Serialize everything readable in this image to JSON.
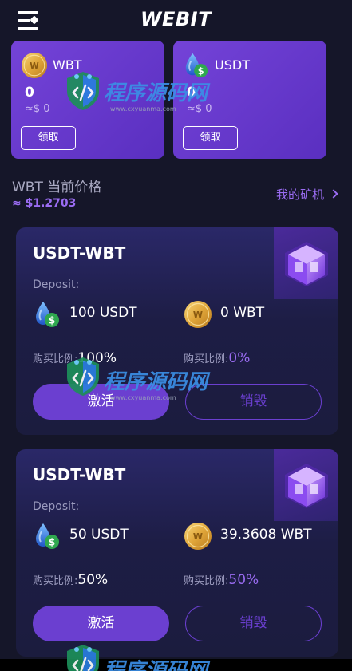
{
  "header": {
    "brand": "WEBIT",
    "menu_icon": "menu-icon"
  },
  "tokens": [
    {
      "symbol": "WBT",
      "amount": "0",
      "fiat": "≈$ 0",
      "claim_label": "领取",
      "icon": "wbt-coin-icon",
      "color": "#e2a93a"
    },
    {
      "symbol": "USDT",
      "amount": "0",
      "fiat": "≈$ 0",
      "claim_label": "领取",
      "icon": "usdt-drop-icon",
      "color": "#2f6fe0"
    }
  ],
  "price": {
    "label": "WBT 当前价格",
    "value": "≈ $1.2703"
  },
  "my_miner": {
    "label": "我的矿机",
    "icon": "chevron-right-icon"
  },
  "pools": [
    {
      "title": "USDT-WBT",
      "deposit_label": "Deposit:",
      "left_amount": "100 USDT",
      "right_amount": "0 WBT",
      "ratio_label_left": "购买比例:",
      "ratio_value_left": "100%",
      "ratio_label_right": "购买比例:",
      "ratio_value_right": "0%",
      "activate_label": "激活",
      "destroy_label": "销毁"
    },
    {
      "title": "USDT-WBT",
      "deposit_label": "Deposit:",
      "left_amount": "50 USDT",
      "right_amount": "39.3608 WBT",
      "ratio_label_left": "购买比例:",
      "ratio_value_left": "50%",
      "ratio_label_right": "购买比例:",
      "ratio_value_right": "50%",
      "activate_label": "激活",
      "destroy_label": "销毁"
    }
  ],
  "watermark": {
    "text": "程序源码网",
    "url_text": "www.cxyuanma.com"
  },
  "colors": {
    "background": "#151629",
    "accent": "#6b3fd0",
    "accent_text": "#9a6cf2",
    "card": "#7443d8"
  }
}
